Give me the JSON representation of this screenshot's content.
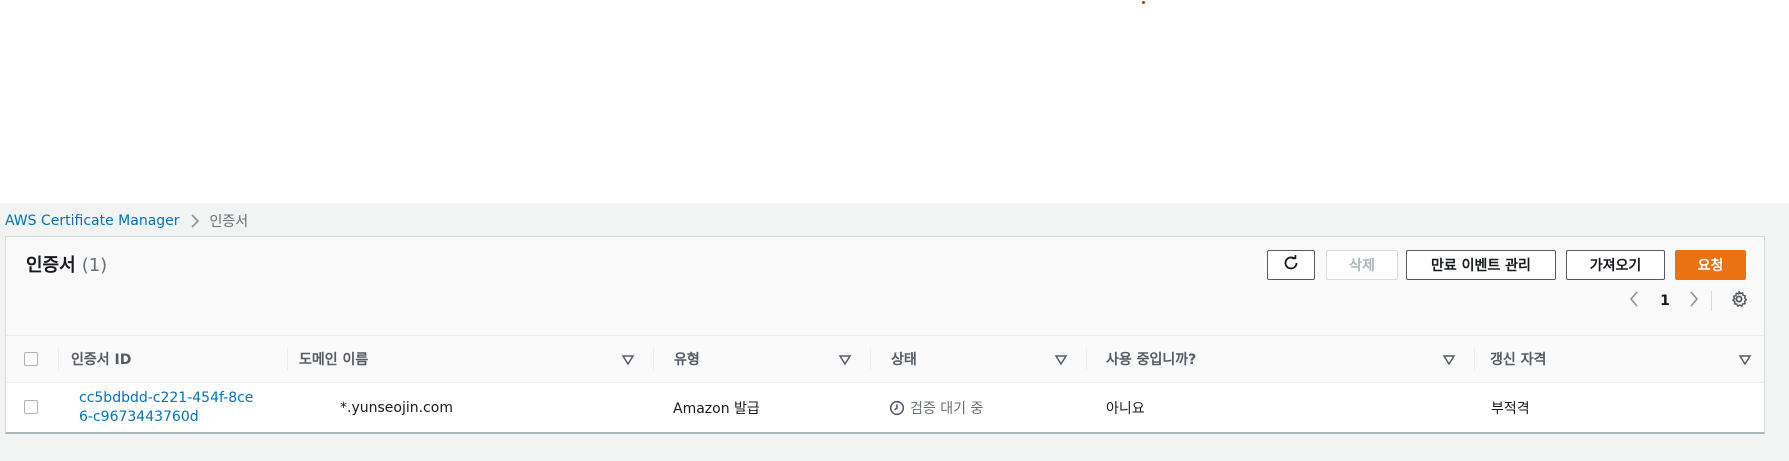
{
  "breadcrumb": {
    "service": "AWS Certificate Manager",
    "current": "인증서"
  },
  "panel": {
    "title": "인증서",
    "count": "(1)"
  },
  "buttons": {
    "delete": "삭제",
    "expiry_events": "만료 이벤트 관리",
    "import": "가져오기",
    "request": "요청"
  },
  "pagination": {
    "current_page": "1"
  },
  "table": {
    "columns": [
      {
        "label": "인증서 ID"
      },
      {
        "label": "도메인 이름"
      },
      {
        "label": "유형"
      },
      {
        "label": "상태"
      },
      {
        "label": "사용 중입니까?"
      },
      {
        "label": "갱신 자격"
      }
    ],
    "rows": [
      {
        "certificate_id": "cc5bdbdd-c221-454f-8ce6-c9673443760d",
        "domain": "*.yunseojin.com",
        "type": "Amazon 발급",
        "status": "검증 대기 중",
        "in_use": "아니요",
        "renewal": "부적격"
      }
    ]
  },
  "colors": {
    "link": "#0073bb",
    "primary_button": "#ec7211",
    "background": "#f2f3f3"
  },
  "icons": [
    "chevron-right-icon",
    "refresh-icon",
    "chevron-left-icon",
    "chevron-right-icon",
    "gear-icon",
    "sort-down-icon",
    "clock-icon"
  ]
}
